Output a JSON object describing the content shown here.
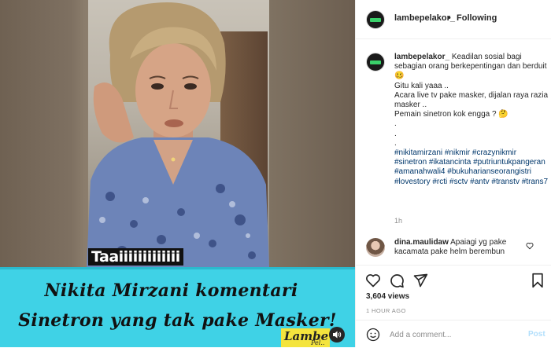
{
  "header": {
    "username": "lambepelakor_",
    "separator": "•",
    "follow_label": "Following"
  },
  "caption": {
    "username": "lambepelakor_",
    "text_lines": [
      "Keadilan sosial bagi sebagian orang berkepentingan dan berduit 🥴",
      "Gitu kali yaaa ..",
      "Acara live tv pake masker, dijalan raya razia masker ..",
      "Pemain sinetron kok engga ? 🤔",
      ".",
      ".",
      "."
    ],
    "hashtags": "#nikitamirzani #nikmir #crazynikmir #sinetron #ikatancinta #putriuntukpangeran #amanahwali4 #bukuharianseorangistri #lovestory #rcti #sctv #antv #transtv #trans7",
    "time": "1h"
  },
  "comment": {
    "username": "dina.maulidaw",
    "text": "Apaiagi yg pake kacamata pake helm berembun"
  },
  "media": {
    "overlay_text": "Taaiiiiiiiiiiiii",
    "banner_line1": "Nikita Mirzani komentari",
    "banner_line2": "Sinetron yang tak pake Masker!",
    "logo_text": "Lambe",
    "logo_sub": "Pel.."
  },
  "stats": {
    "views": "3,604 views",
    "time_ago": "1 HOUR AGO"
  },
  "add_comment": {
    "placeholder": "Add a comment...",
    "post_label": "Post"
  },
  "colors": {
    "accent": "#0095f6",
    "banner": "#3fd2e6",
    "link": "#00376b",
    "muted": "#8e8e8e"
  }
}
